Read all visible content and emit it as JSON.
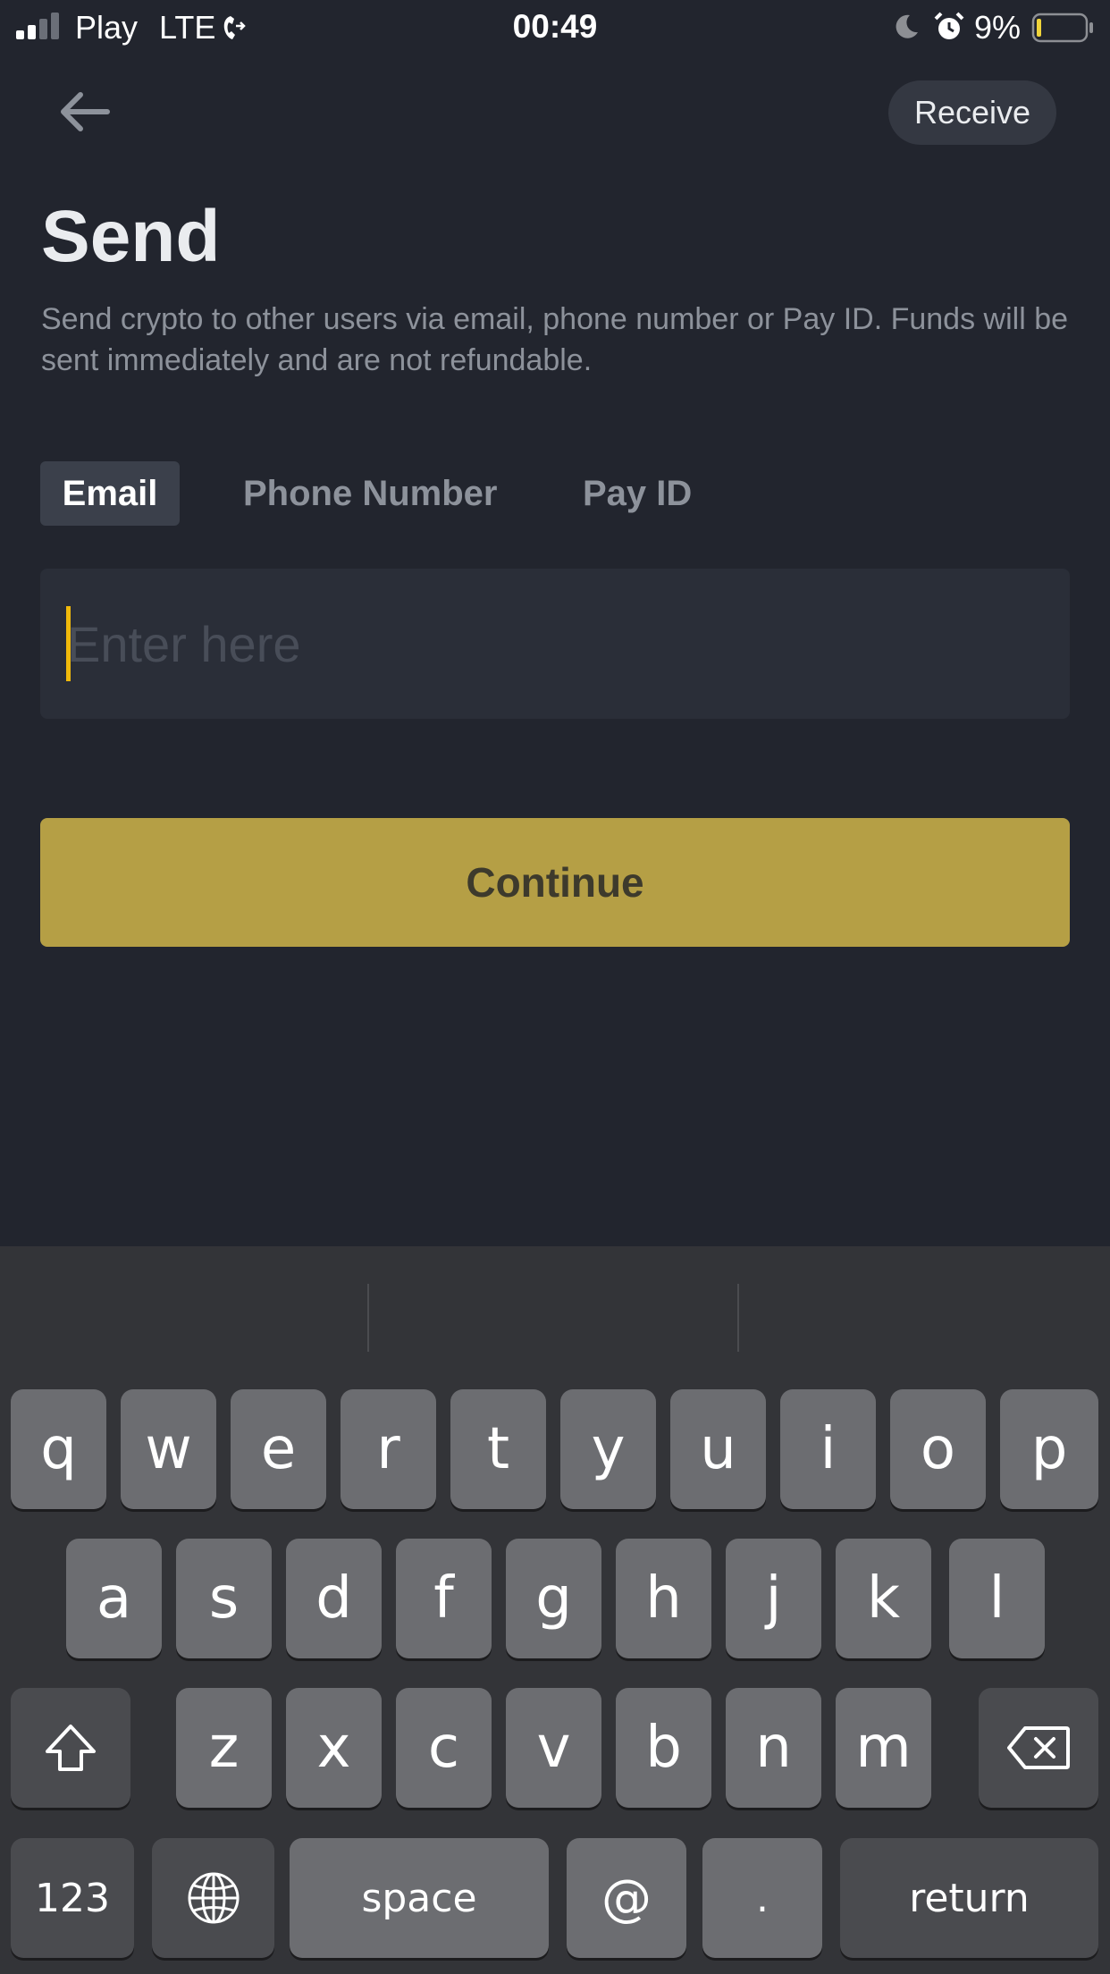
{
  "status_bar": {
    "carrier": "Play",
    "network": "LTE",
    "time": "00:49",
    "battery": "9%",
    "icons": [
      "signal-icon",
      "call-forward-icon",
      "moon-icon",
      "alarm-icon",
      "battery-icon"
    ]
  },
  "header": {
    "back_icon": "arrow-left-icon",
    "receive_label": "Receive",
    "title": "Send",
    "description": "Send crypto to other users via email, phone number or Pay ID. Funds will be sent immediately and are not refundable."
  },
  "tabs": [
    {
      "label": "Email",
      "selected": true
    },
    {
      "label": "Phone Number",
      "selected": false
    },
    {
      "label": "Pay ID",
      "selected": false
    }
  ],
  "input": {
    "value": "",
    "placeholder": "Enter here"
  },
  "continue_label": "Continue",
  "colors": {
    "background": "#22252e",
    "accent": "#f0b90b",
    "button": "#b59f45",
    "keyboard": "#333438"
  },
  "keyboard": {
    "row1": [
      "q",
      "w",
      "e",
      "r",
      "t",
      "y",
      "u",
      "i",
      "o",
      "p"
    ],
    "row2": [
      "a",
      "s",
      "d",
      "f",
      "g",
      "h",
      "j",
      "k",
      "l"
    ],
    "row3": [
      "z",
      "x",
      "c",
      "v",
      "b",
      "n",
      "m"
    ],
    "numbers_label": "123",
    "space_label": "space",
    "at_label": "@",
    "dot_label": ".",
    "return_label": "return",
    "special_icons": [
      "shift-icon",
      "backspace-icon",
      "globe-icon"
    ]
  }
}
